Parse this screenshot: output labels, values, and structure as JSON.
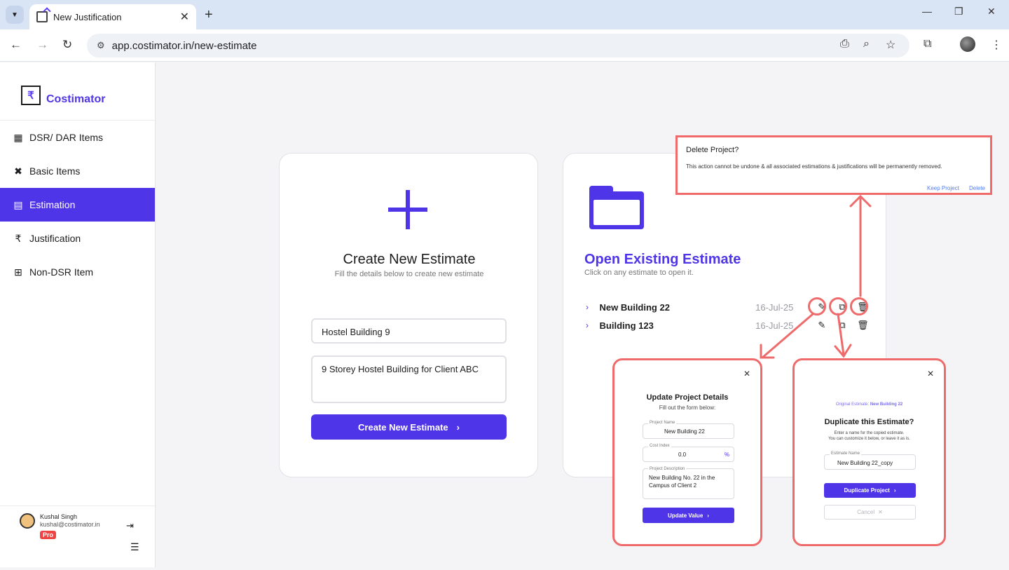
{
  "browser": {
    "tab_title": "New Justification",
    "url": "app.costimator.in/new-estimate"
  },
  "sidebar": {
    "brand": "Costimator",
    "items": [
      {
        "label": "DSR/ DAR Items",
        "icon": "table-icon"
      },
      {
        "label": "Basic Items",
        "icon": "tools-icon"
      },
      {
        "label": "Estimation",
        "icon": "grid-icon",
        "active": true
      },
      {
        "label": "Justification",
        "icon": "rupee-icon"
      },
      {
        "label": "Non-DSR Item",
        "icon": "add-box-icon"
      }
    ],
    "user": {
      "name": "Kushal Singh",
      "email": "kushal@costimator.in",
      "plan": "Pro"
    }
  },
  "create_card": {
    "title": "Create New Estimate",
    "subtitle": "Fill the details below to create new estimate",
    "name_value": "Hostel Building 9",
    "desc_value": "9 Storey Hostel Building for Client ABC",
    "button": "Create New Estimate"
  },
  "open_card": {
    "title": "Open Existing Estimate",
    "subtitle": "Click on any estimate to open it.",
    "rows": [
      {
        "name": "New Building 22",
        "date": "16-Jul-25"
      },
      {
        "name": "Building 123",
        "date": "16-Jul-25"
      }
    ]
  },
  "delete_dialog": {
    "title": "Delete Project?",
    "message": "This action cannot be undone & all associated estimations & justifications will be permanently removed.",
    "keep": "Keep Project",
    "delete": "Delete"
  },
  "update_dialog": {
    "title": "Update Project Details",
    "subtitle": "Fill out the form below:",
    "project_name_label": "Project Name",
    "project_name": "New Building 22",
    "cost_index_label": "Cost Index",
    "cost_index": "0.0",
    "cost_index_unit": "%",
    "desc_label": "Project Description",
    "desc": "New Building No. 22 in the Campus of Client 2",
    "button": "Update Value"
  },
  "duplicate_dialog": {
    "original_label": "Original Estimate:",
    "original_name": "New Building 22",
    "title": "Duplicate this Estimate?",
    "line1": "Enter a name for the copied estimate.",
    "line2": "You can customize it below, or leave it as is.",
    "name_label": "Estimate Name",
    "name_value": "New Building 22_copy",
    "button": "Duplicate Project",
    "cancel": "Cancel"
  },
  "colors": {
    "accent": "#4f35e8",
    "highlight": "#ef6b6b"
  }
}
